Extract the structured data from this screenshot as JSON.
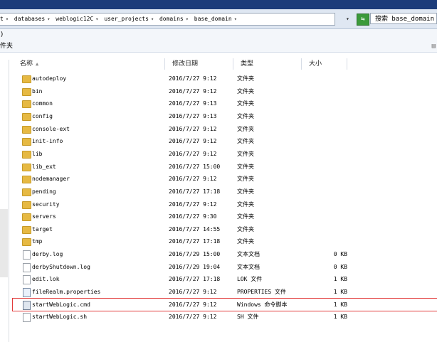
{
  "window": {
    "titlebar_color": "#1c3c7a"
  },
  "address": {
    "crumbs": [
      "t",
      "databases",
      "weblogic12C",
      "user_projects",
      "domains",
      "base_domain"
    ],
    "refresh_icon": "refresh-arrows-icon"
  },
  "search": {
    "label": "搜索 base_domain"
  },
  "menubar": {
    "partial_text": ")"
  },
  "toolbar": {
    "partial_text": "件夹"
  },
  "columns": {
    "name": "名称",
    "date": "修改日期",
    "type": "类型",
    "size": "大小"
  },
  "files": [
    {
      "name": "autodeploy",
      "date": "2016/7/27 9:12",
      "type": "文件夹",
      "size": "",
      "icon": "folder-icon"
    },
    {
      "name": "bin",
      "date": "2016/7/27 9:12",
      "type": "文件夹",
      "size": "",
      "icon": "folder-icon"
    },
    {
      "name": "common",
      "date": "2016/7/27 9:13",
      "type": "文件夹",
      "size": "",
      "icon": "folder-icon"
    },
    {
      "name": "config",
      "date": "2016/7/27 9:13",
      "type": "文件夹",
      "size": "",
      "icon": "folder-icon"
    },
    {
      "name": "console-ext",
      "date": "2016/7/27 9:12",
      "type": "文件夹",
      "size": "",
      "icon": "folder-icon"
    },
    {
      "name": "init-info",
      "date": "2016/7/27 9:12",
      "type": "文件夹",
      "size": "",
      "icon": "folder-icon"
    },
    {
      "name": "lib",
      "date": "2016/7/27 9:12",
      "type": "文件夹",
      "size": "",
      "icon": "folder-icon"
    },
    {
      "name": "lib_ext",
      "date": "2016/7/27 15:00",
      "type": "文件夹",
      "size": "",
      "icon": "folder-icon"
    },
    {
      "name": "nodemanager",
      "date": "2016/7/27 9:12",
      "type": "文件夹",
      "size": "",
      "icon": "folder-icon"
    },
    {
      "name": "pending",
      "date": "2016/7/27 17:18",
      "type": "文件夹",
      "size": "",
      "icon": "folder-icon"
    },
    {
      "name": "security",
      "date": "2016/7/27 9:12",
      "type": "文件夹",
      "size": "",
      "icon": "folder-icon"
    },
    {
      "name": "servers",
      "date": "2016/7/27 9:30",
      "type": "文件夹",
      "size": "",
      "icon": "folder-icon"
    },
    {
      "name": "target",
      "date": "2016/7/27 14:55",
      "type": "文件夹",
      "size": "",
      "icon": "folder-icon"
    },
    {
      "name": "tmp",
      "date": "2016/7/27 17:18",
      "type": "文件夹",
      "size": "",
      "icon": "folder-icon"
    },
    {
      "name": "derby.log",
      "date": "2016/7/29 15:00",
      "type": "文本文档",
      "size": "0 KB",
      "icon": "document-icon"
    },
    {
      "name": "derbyShutdown.log",
      "date": "2016/7/29 19:04",
      "type": "文本文档",
      "size": "0 KB",
      "icon": "document-icon"
    },
    {
      "name": "edit.lok",
      "date": "2016/7/27 17:18",
      "type": "LOK 文件",
      "size": "1 KB",
      "icon": "document-icon"
    },
    {
      "name": "fileRealm.properties",
      "date": "2016/7/27 9:12",
      "type": "PROPERTIES 文件",
      "size": "1 KB",
      "icon": "properties-file-icon"
    },
    {
      "name": "startWebLogic.cmd",
      "date": "2016/7/27 9:12",
      "type": "Windows 命令脚本",
      "size": "1 KB",
      "icon": "command-script-icon",
      "highlight_color": "#e23b3b"
    },
    {
      "name": "startWebLogic.sh",
      "date": "2016/7/27 9:12",
      "type": "SH 文件",
      "size": "1 KB",
      "icon": "document-icon"
    }
  ]
}
